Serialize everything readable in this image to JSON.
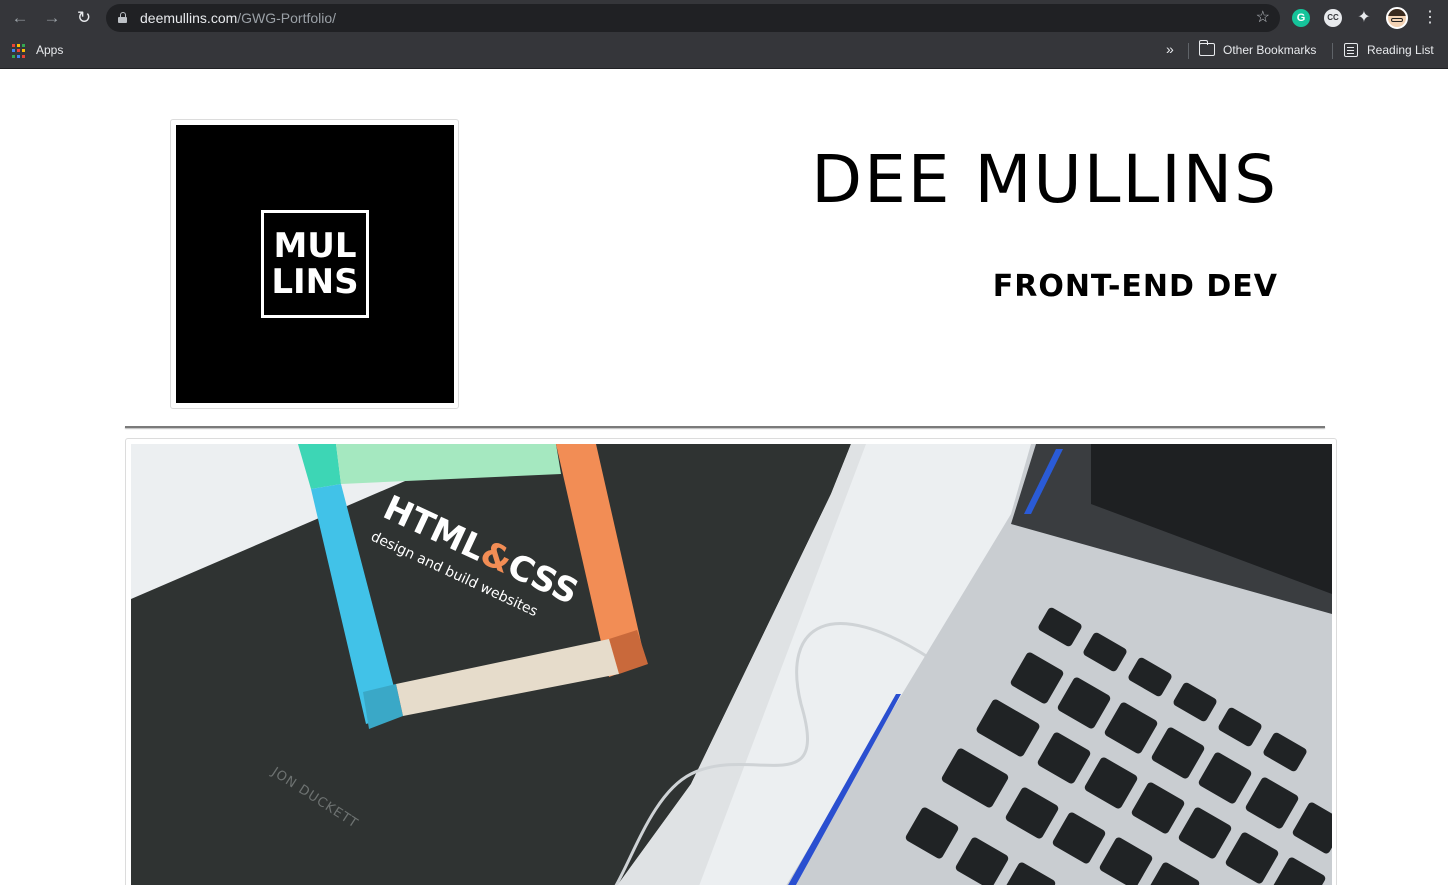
{
  "browser": {
    "url_host": "deemullins.com",
    "url_path": "/GWG-Portfolio/",
    "icons": {
      "back": "arrow-left-icon",
      "forward": "arrow-right-icon",
      "reload": "reload-icon",
      "lock": "lock-icon",
      "bookmark_star": "star-icon",
      "grammarly": "grammarly-icon",
      "extension_cc": "cc-icon",
      "extensions": "puzzle-icon",
      "profile": "avatar",
      "menu": "kebab-menu-icon"
    },
    "grammarly_letter": "G",
    "cc_letters": "CC",
    "bookmarks": {
      "apps_label": "Apps",
      "other_bookmarks_label": "Other Bookmarks",
      "reading_list_label": "Reading List"
    },
    "colors": {
      "toolbar_bg": "#35363a",
      "omnibox_bg": "#202124",
      "text": "#e8eaed"
    }
  },
  "page": {
    "logo": {
      "line1": "MUL",
      "line2": "LINS"
    },
    "title": "DEE MULLINS",
    "subtitle": "FRONT-END DEV",
    "hero_image": {
      "book_title_part1": "HTML",
      "book_title_amp": "&",
      "book_title_part2": "CSS",
      "book_tagline": "design and build websites",
      "book_author": "JON DUCKETT",
      "colors": {
        "book_cover": "#2f3332",
        "teal": "#3dd6b5",
        "blue": "#41c2e8",
        "orange": "#f28d55",
        "beige": "#e6dccb",
        "mint": "#a5e8c0",
        "laptop": "#c9cdd1",
        "key": "#202325"
      }
    }
  }
}
